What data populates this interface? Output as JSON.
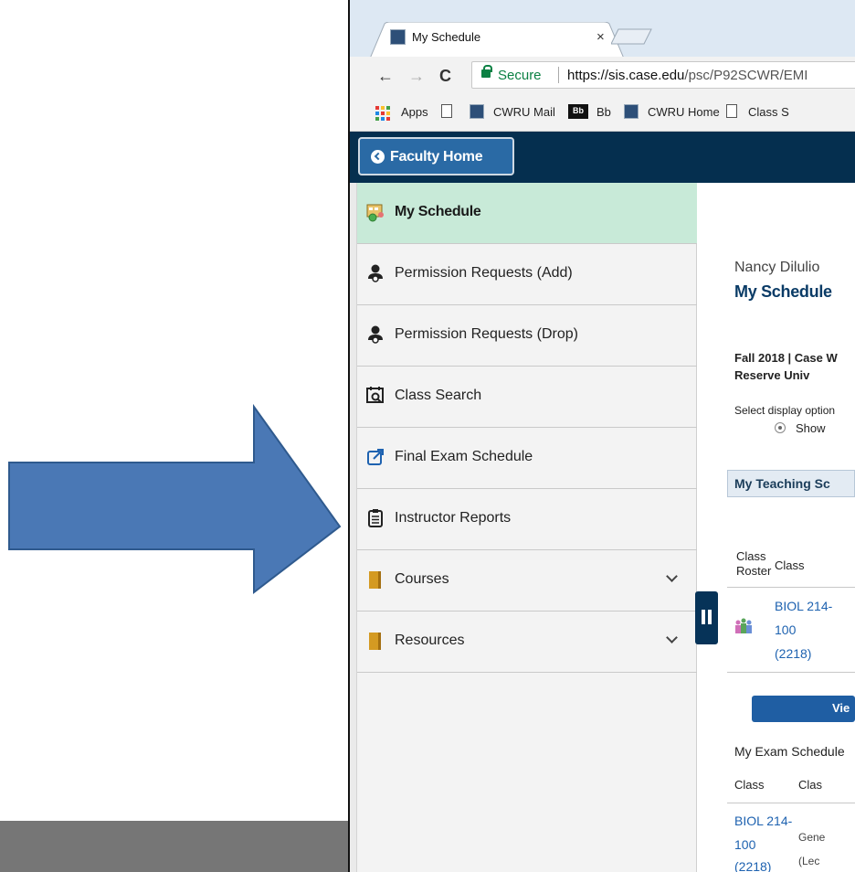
{
  "browser": {
    "tab_title": "My Schedule",
    "tab_close": "×",
    "back": "←",
    "forward": "→",
    "reload": "C",
    "secure_label": "Secure",
    "url_host": "https://sis.case.edu",
    "url_path": "/psc/P92SCWR/EMI"
  },
  "bookmarks": [
    {
      "label": "Apps",
      "icon": "apps-grid-icon"
    },
    {
      "label": "",
      "icon": "page-icon"
    },
    {
      "label": "CWRU Mail",
      "icon": "case-logo-icon"
    },
    {
      "label": "Bb",
      "icon": "blackboard-icon",
      "badge": "Bb"
    },
    {
      "label": "CWRU Home",
      "icon": "case-logo-icon"
    },
    {
      "label": "Class S",
      "icon": "page-icon"
    }
  ],
  "navbar": {
    "home_button": "Faculty Home"
  },
  "sidebar": {
    "items": [
      {
        "label": "My Schedule",
        "icon": "schedule-icon",
        "active": true
      },
      {
        "label": "Permission Requests (Add)",
        "icon": "person-icon"
      },
      {
        "label": "Permission Requests (Drop)",
        "icon": "person-icon"
      },
      {
        "label": "Class Search",
        "icon": "class-search-icon"
      },
      {
        "label": "Final Exam Schedule",
        "icon": "external-link-icon"
      },
      {
        "label": "Instructor Reports",
        "icon": "report-icon"
      },
      {
        "label": "Courses",
        "icon": "book-icon",
        "expandable": true
      },
      {
        "label": "Resources",
        "icon": "book-icon",
        "expandable": true
      }
    ]
  },
  "content": {
    "name": "Nancy Dilulio",
    "title": "My Schedule",
    "term": "Fall 2018 | Case W Reserve Univ",
    "select_display": "Select display option",
    "show_option": "Show",
    "teaching_header": "My Teaching Sc",
    "col_class_roster": "Class Roster",
    "col_class": "Class",
    "class_link_1": "BIOL 214-",
    "class_link_2": "100",
    "class_link_3": "(2218)",
    "view_button": "Vie",
    "exam_header": "My Exam Schedule",
    "exam_col_class": "Class",
    "exam_col_class2": "Clas",
    "exam_class_1": "BIOL 214-",
    "exam_class_2": "100",
    "exam_class_3": "(2218)",
    "exam_desc_1": "Gene",
    "exam_desc_2": "(Lec"
  },
  "colors": {
    "arrow": "#4a78b5",
    "navbar": "#052f4f",
    "active_item": "#c8ead8",
    "link": "#1e62b0"
  }
}
